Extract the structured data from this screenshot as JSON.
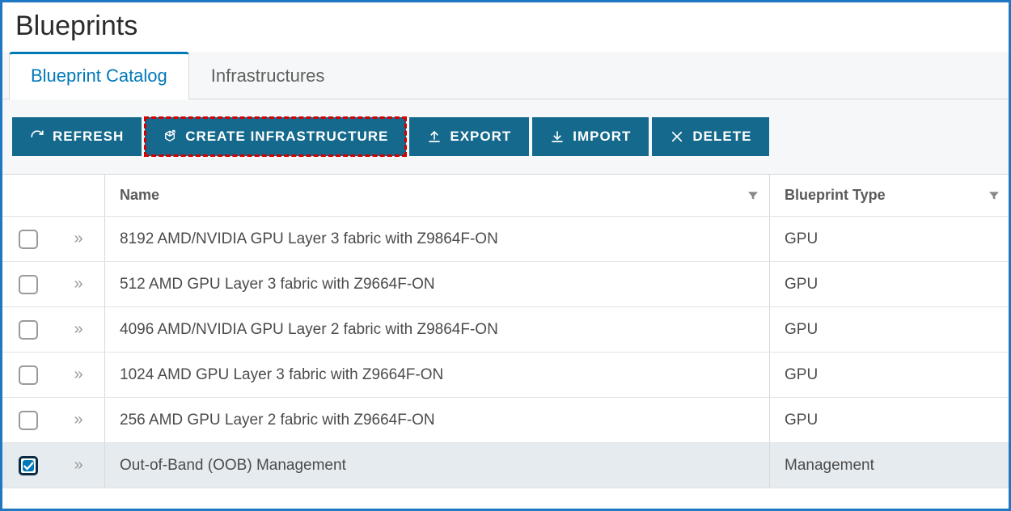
{
  "page": {
    "title": "Blueprints"
  },
  "tabs": [
    {
      "label": "Blueprint Catalog",
      "active": true
    },
    {
      "label": "Infrastructures",
      "active": false
    }
  ],
  "toolbar": {
    "refresh": "REFRESH",
    "create": "CREATE INFRASTRUCTURE",
    "export": "EXPORT",
    "import": "IMPORT",
    "delete": "DELETE"
  },
  "columns": {
    "name": "Name",
    "type": "Blueprint Type"
  },
  "rows": [
    {
      "checked": false,
      "name": "8192 AMD/NVIDIA GPU Layer 3 fabric with Z9864F-ON",
      "type": "GPU"
    },
    {
      "checked": false,
      "name": "512 AMD GPU Layer 3 fabric with Z9664F-ON",
      "type": "GPU"
    },
    {
      "checked": false,
      "name": "4096 AMD/NVIDIA GPU Layer 2 fabric with Z9864F-ON",
      "type": "GPU"
    },
    {
      "checked": false,
      "name": "1024 AMD GPU Layer 3 fabric with Z9664F-ON",
      "type": "GPU"
    },
    {
      "checked": false,
      "name": "256 AMD GPU Layer 2 fabric with Z9664F-ON",
      "type": "GPU"
    },
    {
      "checked": true,
      "name": "Out-of-Band (OOB) Management",
      "type": "Management"
    }
  ]
}
